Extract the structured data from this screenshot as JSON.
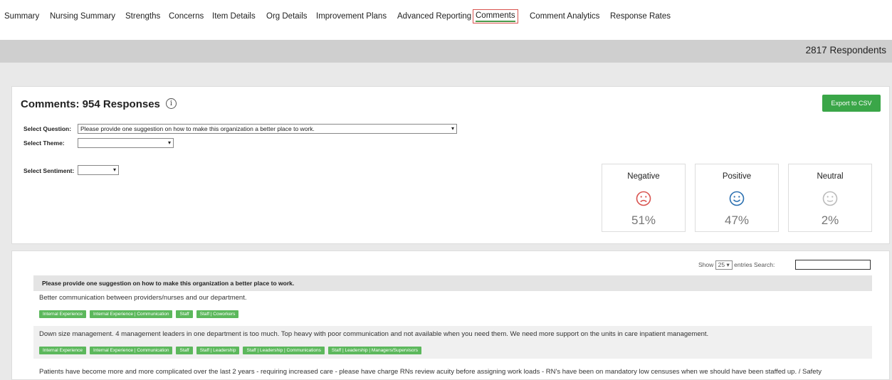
{
  "nav": {
    "tabs": [
      "Summary",
      "Nursing Summary",
      "Strengths",
      "Concerns",
      "Item Details",
      "Org Details",
      "Improvement Plans",
      "Advanced Reporting",
      "Comments",
      "Comment Analytics",
      "Response Rates"
    ],
    "active": "Comments"
  },
  "header": {
    "respondents": "2817 Respondents"
  },
  "comments": {
    "title": "Comments: 954 Responses",
    "info_icon": "info-icon",
    "export_label": "Export to CSV",
    "question_label": "Select Question:",
    "question_value": "Please provide one suggestion on how to make this organization a better place to work.",
    "theme_label": "Select Theme:",
    "theme_value": "",
    "sentiment_label": "Select Sentiment:",
    "sentiment_value": ""
  },
  "sentiment": [
    {
      "label": "Negative",
      "percent": "51%",
      "icon": "sad-face-icon",
      "color": "#d9534f"
    },
    {
      "label": "Positive",
      "percent": "47%",
      "icon": "smile-face-icon",
      "color": "#2a6fb0"
    },
    {
      "label": "Neutral",
      "percent": "2%",
      "icon": "neutral-face-icon",
      "color": "#bbbbbb"
    }
  ],
  "table": {
    "show_label": "Show",
    "entries_value": "25",
    "entries_label": "entries",
    "search_label": "Search:",
    "column_header": "Please provide one suggestion on how to make this organization a better place to work.",
    "rows": [
      {
        "text": "Better communication between providers/nurses and our department.",
        "tags": [
          "Internal Experience",
          "Internal Experience | Communication",
          "Staff",
          "Staff | Coworkers"
        ]
      },
      {
        "text": "Down size management. 4 management leaders in one department is too much. Top heavy with poor communication and not available when you need them. We need more support on the units in care inpatient management.",
        "tags": [
          "Internal Experience",
          "Internal Experience | Communication",
          "Staff",
          "Staff | Leadership",
          "Staff | Leadership | Communications",
          "Staff | Leadership | Managers/Supervisors"
        ]
      },
      {
        "text": "Patients have become more and more complicated over the last 2 years - requiring increased care - please have charge RNs review acuity before assigning work loads - RN's have been on mandatory low censuses when we should have been staffed up. / Safety",
        "tags": []
      }
    ]
  },
  "colors": {
    "accent": "#3aa648",
    "active_border": "#d9534f",
    "tag": "#5cb85c"
  }
}
